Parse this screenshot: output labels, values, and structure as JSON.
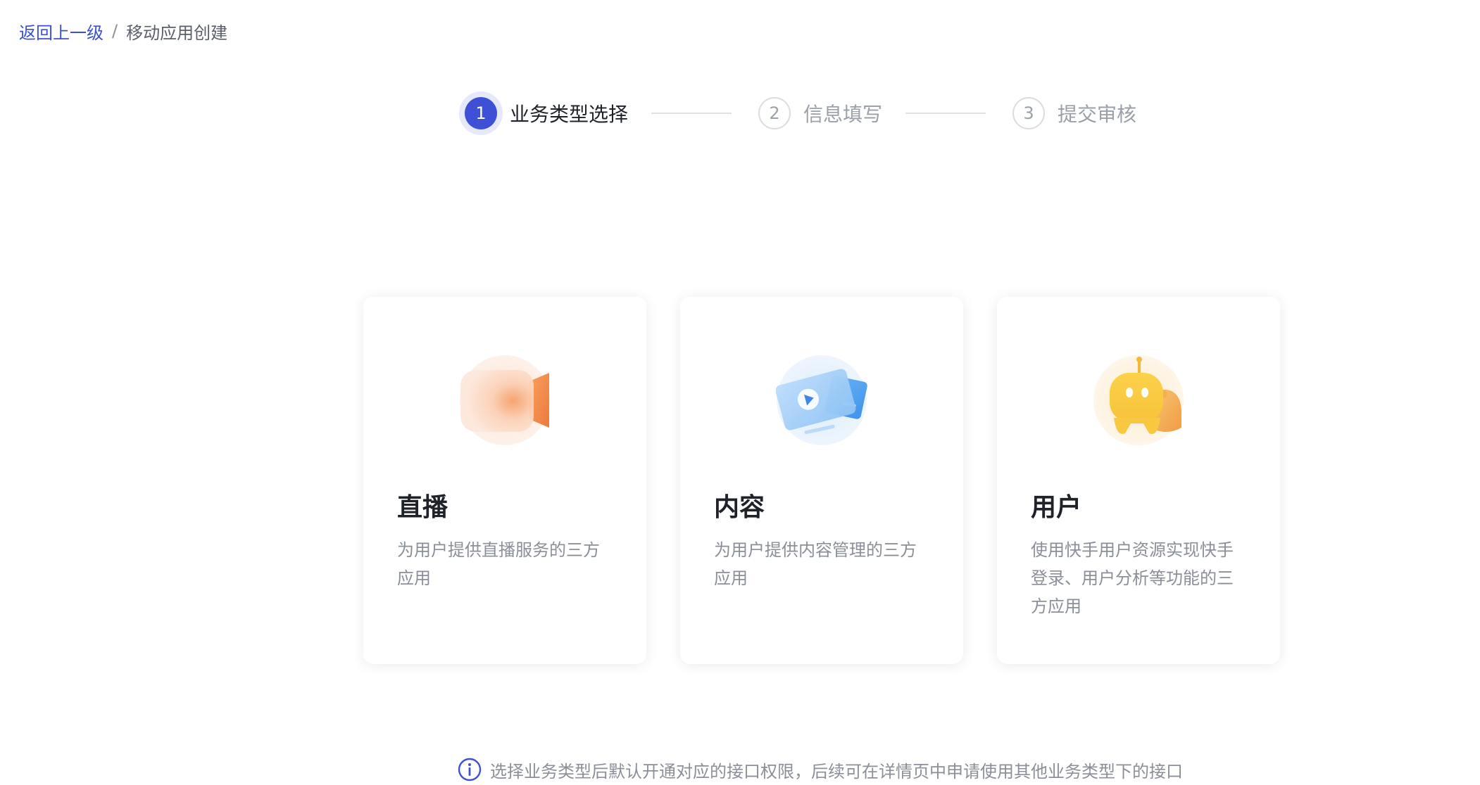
{
  "breadcrumb": {
    "back": "返回上一级",
    "separator": "/",
    "current": "移动应用创建"
  },
  "steps": [
    {
      "number": "1",
      "label": "业务类型选择",
      "state": "active"
    },
    {
      "number": "2",
      "label": "信息填写",
      "state": "inactive"
    },
    {
      "number": "3",
      "label": "提交审核",
      "state": "inactive"
    }
  ],
  "cards": [
    {
      "title": "直播",
      "description": "为用户提供直播服务的三方应用",
      "icon": "video-camera-icon"
    },
    {
      "title": "内容",
      "description": "为用户提供内容管理的三方应用",
      "icon": "content-cards-icon"
    },
    {
      "title": "用户",
      "description": "使用快手用户资源实现快手登录、用户分析等功能的三方应用",
      "icon": "user-mascot-icon"
    }
  ],
  "note": {
    "icon": "info-circle-icon",
    "text": "选择业务类型后默认开通对应的接口权限，后续可在详情页中申请使用其他业务类型下的接口"
  },
  "colors": {
    "accent": "#3e51d6",
    "link": "#3a4fd4",
    "muted_text": "#8a8f99"
  }
}
